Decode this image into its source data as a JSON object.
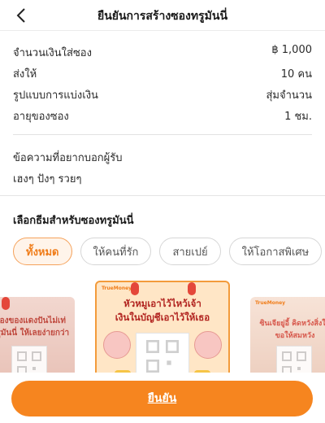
{
  "header": {
    "title": "ยืนยันการสร้างซองทรูมันนี่"
  },
  "summary": [
    {
      "label": "จำนวนเงินใส่ซอง",
      "value": "฿ 1,000"
    },
    {
      "label": "ส่งให้",
      "value": "10 คน"
    },
    {
      "label": "รูปแบบการแบ่งเงิน",
      "value": "สุ่มจำนวน"
    },
    {
      "label": "อายุของซอง",
      "value": "1 ชม."
    }
  ],
  "message": {
    "label": "ข้อความที่อยากบอกผู้รับ",
    "value": "เฮงๆ ปังๆ รวยๆ"
  },
  "theme": {
    "title": "เลือกธีมสำหรับซองทรูมันนี่",
    "chips": [
      "ทั้งหมด",
      "ให้คนที่รัก",
      "สายเปย์",
      "ให้โอกาสพิเศษ"
    ],
    "active_chip": "ทั้งหมด"
  },
  "cards": {
    "left_text": "ห้องของแดงปันไม่เท่ ทรูมันนี่ ให้เลยง่ายกว่า",
    "center_brand": "TrueMoney",
    "center_text_1": "หัวหมูเอาไว้ไหว้เจ้า",
    "center_text_2": "เงินในบัญชีเอาไว้ให้เธอ",
    "right_brand": "TrueMoney",
    "right_text": "ซินเจียยู่อี้ คิดหวังสิ่งใดขอให้สมหวัง"
  },
  "footer": {
    "confirm_label": "ยืนยัน"
  },
  "colors": {
    "accent": "#f6851f",
    "chip_active_bg": "#fff4ea"
  }
}
